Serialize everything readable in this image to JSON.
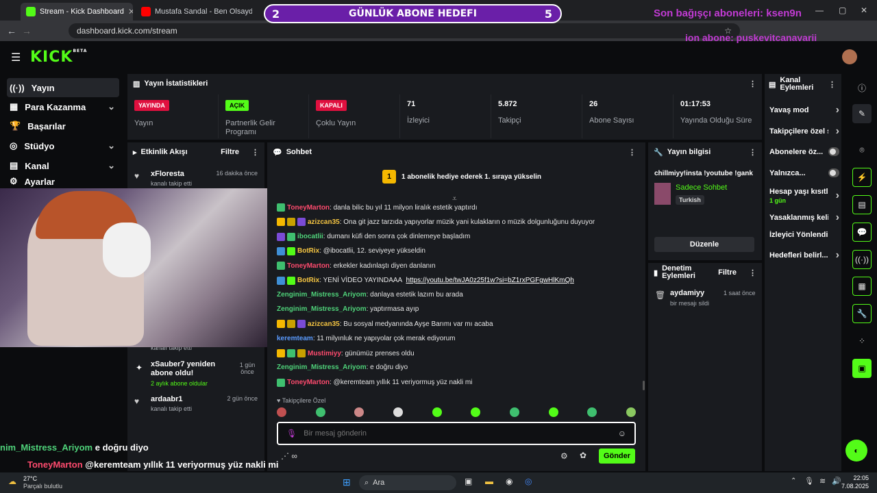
{
  "browser": {
    "tabs": [
      {
        "title": "Stream - Kick Dashboard",
        "active": true
      },
      {
        "title": "Mustafa Sandal - Ben Olsaydı",
        "active": false
      }
    ],
    "url": "dashboard.kick.com/stream"
  },
  "overlay": {
    "goal_left": "2",
    "goal_title": "GÜNLÜK ABONE HEDEFI",
    "goal_right": "5",
    "donor_line": "Son bağışçı aboneleri: ksen9n",
    "sub_line": "ion abone: puskevitcanavarii",
    "chat_overlay": [
      {
        "user": "nim_Mistress_Ariyom",
        "text": "e doğru diyo"
      },
      {
        "user": "ToneyMarton",
        "text": "@keremteam yıllık 11 veriyormuş yüz nakli mi"
      }
    ]
  },
  "kick": {
    "logo": "KICK",
    "beta": "BETA"
  },
  "sidebar": {
    "items": [
      {
        "label": "Yayın",
        "icon": "broadcast-icon",
        "active": true,
        "chevron": false
      },
      {
        "label": "Para Kazanma",
        "icon": "money-icon",
        "active": false,
        "chevron": true
      },
      {
        "label": "Başarılar",
        "icon": "trophy-icon",
        "active": false,
        "chevron": false
      },
      {
        "label": "Stüdyo",
        "icon": "studio-icon",
        "active": false,
        "chevron": true
      },
      {
        "label": "Kanal",
        "icon": "channel-icon",
        "active": false,
        "chevron": true
      },
      {
        "label": "Ayarlar",
        "icon": "settings-icon",
        "active": false,
        "chevron": true
      }
    ]
  },
  "stats": {
    "title": "Yayın İstatistikleri",
    "cards": [
      {
        "value": "YAYINDA",
        "label": "Yayın",
        "badge": true,
        "color": "#e0103f"
      },
      {
        "value": "AÇIK",
        "label": "Partnerlik Gelir Programı",
        "badge": true,
        "color": "#53fc18"
      },
      {
        "value": "KAPALI",
        "label": "Çoklu Yayın",
        "badge": true,
        "color": "#e0103f"
      },
      {
        "value": "71",
        "label": "İzleyici",
        "badge": false
      },
      {
        "value": "5.872",
        "label": "Takipçi",
        "badge": false
      },
      {
        "value": "26",
        "label": "Abone Sayısı",
        "badge": false
      },
      {
        "value": "01:17:53",
        "label": "Yayında Olduğu Süre",
        "badge": false
      }
    ]
  },
  "activity": {
    "title": "Etkinlik Akışı",
    "filter": "Filtre",
    "items": [
      {
        "name": "xFloresta",
        "detail": "kanalı takip etti",
        "time": "16 dakika önce",
        "icon": "heart-icon"
      },
      {
        "name": "",
        "detail": "kanalı takip etti",
        "time": "",
        "icon": ""
      },
      {
        "name": "xSauber7 yeniden abone oldu!",
        "detail": "2 aylık abone oldular",
        "time": "1 gün önce",
        "icon": "sparkle-icon"
      },
      {
        "name": "ardaabr1",
        "detail": "kanalı takip etti",
        "time": "2 gün önce",
        "icon": "heart-icon"
      }
    ]
  },
  "chat": {
    "title": "Sohbet",
    "pinned": "1 abonelik hediye ederek 1. sıraya yükselin",
    "pinned_num": "1",
    "messages": [
      {
        "user": "ToneyMarton",
        "color": "#ff4b6e",
        "text": ": danla bilic bu yıl 11 milyon liralık estetik yaptırdı",
        "badges": [
          "#3fbf6f"
        ]
      },
      {
        "user": "azizcan35",
        "color": "#f5c542",
        "text": ": Ona git jazz tarzıda yapıyorlar müzik yani kulakların o müzik dolgunluğunu duyuyor",
        "badges": [
          "#f5b800",
          "#c9a100",
          "#7a4bd6"
        ]
      },
      {
        "user": "ibocatlii",
        "color": "#4fd37a",
        "text": ": dumanı küfi den sonra çok dinlemeye başladım",
        "badges": [
          "#7a4bd6",
          "#3fbf6f"
        ]
      },
      {
        "user": "BotRix",
        "color": "#f5c542",
        "text": ": @ibocatlii, 12. seviyeye yükseldin",
        "badges": [
          "#3f8fd6",
          "#53fc18"
        ]
      },
      {
        "user": "ToneyMarton",
        "color": "#ff4b6e",
        "text": ": erkekler kadınlaştı diyen danlanın",
        "badges": [
          "#3fbf6f"
        ]
      },
      {
        "user": "BotRix",
        "color": "#f5c542",
        "text": ": YENİ VİDEO YAYINDAAA ",
        "link": "https://youtu.be/twJA0z25f1w?si=bZ1rxPGFgwHlKmQh",
        "badges": [
          "#3f8fd6",
          "#53fc18"
        ]
      },
      {
        "user": "Zenginim_Mistress_Ariyom",
        "color": "#4fd37a",
        "text": ": danlaya estetik lazım bu arada",
        "badges": []
      },
      {
        "user": "Zenginim_Mistress_Ariyom",
        "color": "#4fd37a",
        "text": ": yaptırmasa ayıp",
        "badges": []
      },
      {
        "user": "azizcan35",
        "color": "#f5c542",
        "text": ": Bu sosyal medyanında Ayşe Barımı var mı acaba",
        "badges": [
          "#f5b800",
          "#c9a100",
          "#7a4bd6"
        ]
      },
      {
        "user": "keremteam",
        "color": "#5a9bff",
        "text": ": 11 milyınluk ne yapıyolar çok merak ediyorum",
        "badges": []
      },
      {
        "user": "Mustimiyy",
        "color": "#ff4b6e",
        "text": ": günümüz prenses oldu",
        "badges": [
          "#f5b800",
          "#3fbf6f",
          "#c9a100"
        ]
      },
      {
        "user": "Zenginim_Mistress_Ariyom",
        "color": "#4fd37a",
        "text": ": e doğru diyo",
        "badges": []
      },
      {
        "user": "ToneyMarton",
        "color": "#ff4b6e",
        "text": ": @keremteam yıllık 11 veriyormuş yüz nakli mi",
        "badges": [
          "#3fbf6f"
        ]
      }
    ],
    "emote_label": "Takipçilere Özel",
    "input_placeholder": "Bir mesaj gönderin",
    "send": "Gönder"
  },
  "streaminfo": {
    "title": "Yayın bilgisi",
    "stream_title": "chillmiyy!insta !youtube !gank",
    "category": "Sadece Sohbet",
    "language": "Turkish",
    "edit": "Düzenle"
  },
  "modactions": {
    "title": "Denetim Eylemleri",
    "filter": "Filtre",
    "items": [
      {
        "user": "aydamiyy",
        "detail": "bir mesajı sildi",
        "time": "1 saat önce"
      }
    ]
  },
  "channel_actions": {
    "title": "Kanal Eylemleri",
    "items": [
      {
        "label": "Yavaş mod",
        "type": "arrow"
      },
      {
        "label": "Takipçilere özel s",
        "type": "arrow"
      },
      {
        "label": "Abonelere öz...",
        "type": "toggle"
      },
      {
        "label": "Yalnızca...",
        "type": "toggle"
      },
      {
        "label": "Hesap yaşı kısıtla",
        "type": "arrow",
        "sub": "1 gün"
      },
      {
        "label": "Yasaklanmış kelim",
        "type": "arrow"
      },
      {
        "label": "İzleyici Yönlendir",
        "type": "none"
      },
      {
        "label": "Hedefleri belirl...",
        "type": "arrow"
      }
    ]
  },
  "taskbar": {
    "weather_temp": "27°C",
    "weather_desc": "Parçalı bulutlu",
    "search": "Ara",
    "time": "22:05",
    "date": "7.08.2025"
  },
  "colors": {
    "kick_green": "#53fc18",
    "panel": "#191b1f",
    "live_red": "#e0103f"
  }
}
